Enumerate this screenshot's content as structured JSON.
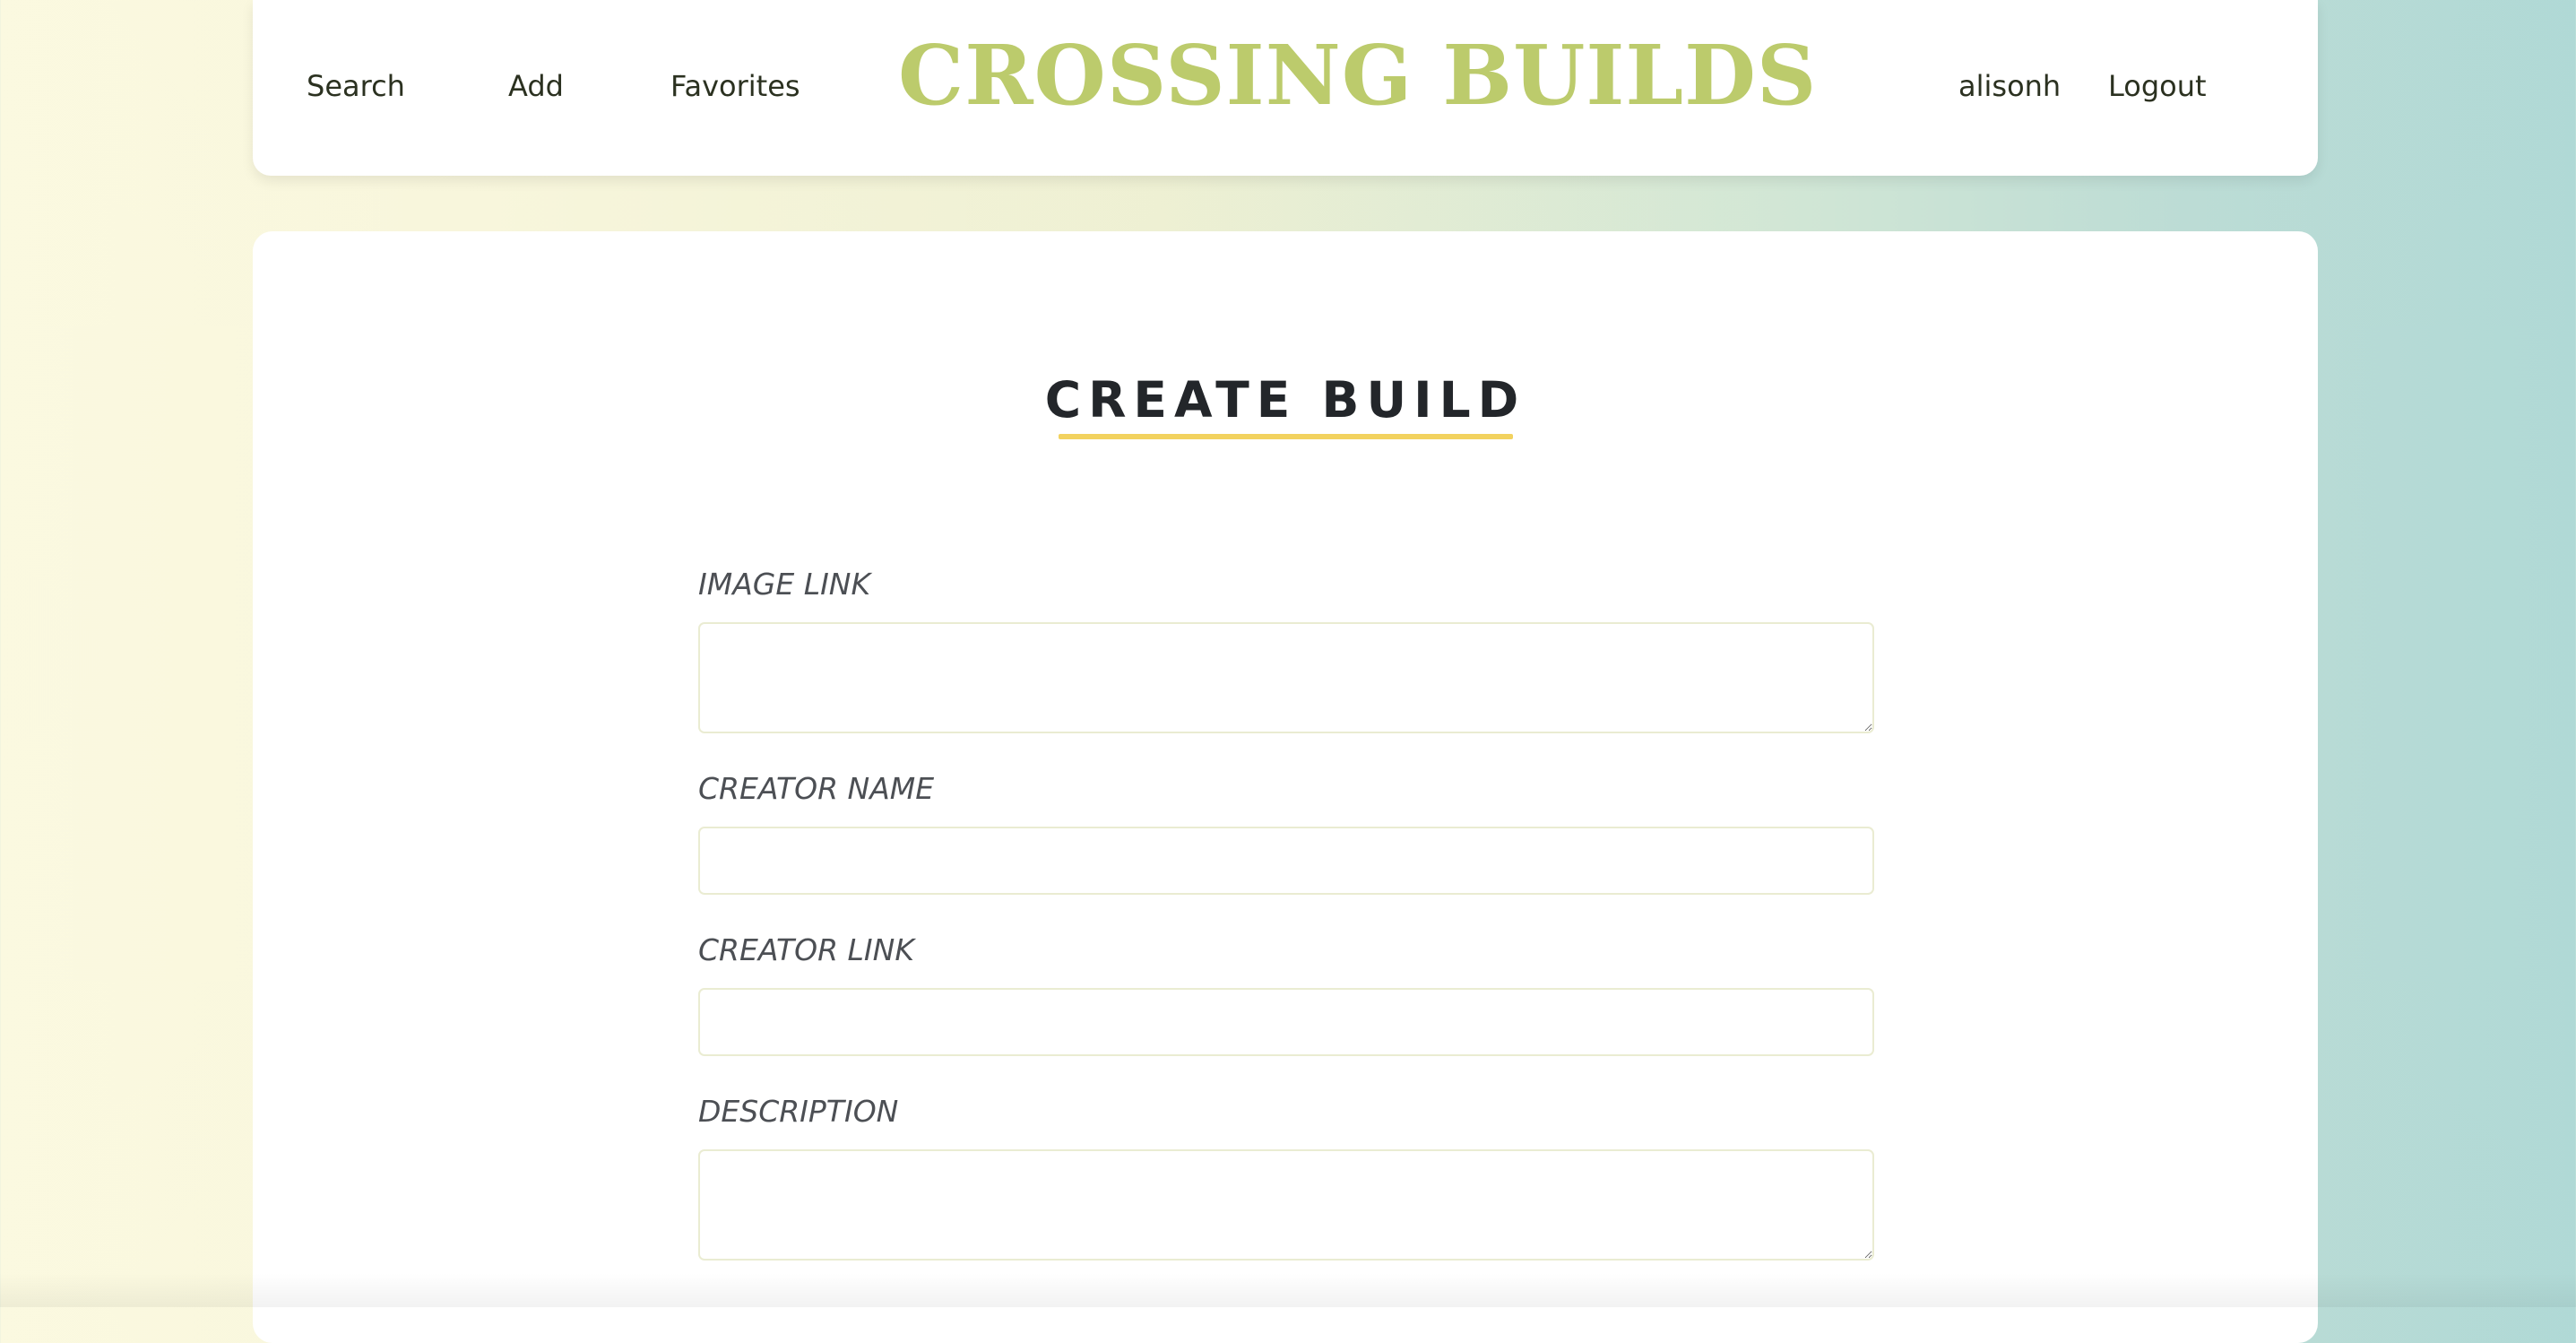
{
  "nav": {
    "search": "Search",
    "add": "Add",
    "favorites": "Favorites",
    "logo": "CROSSING BUILDS",
    "username": "alisonh",
    "logout": "Logout"
  },
  "page": {
    "title": "CREATE BUILD"
  },
  "form": {
    "image_link": {
      "label": "IMAGE LINK",
      "value": ""
    },
    "creator_name": {
      "label": "CREATOR NAME",
      "value": ""
    },
    "creator_link": {
      "label": "CREATOR LINK",
      "value": ""
    },
    "description": {
      "label": "DESCRIPTION",
      "value": ""
    }
  },
  "colors": {
    "logo": "#bccb6c",
    "title_underline": "#f2d25f",
    "field_border": "#eaecd2",
    "background_left": "#fbf9e0",
    "background_right": "#b0d9d6"
  }
}
